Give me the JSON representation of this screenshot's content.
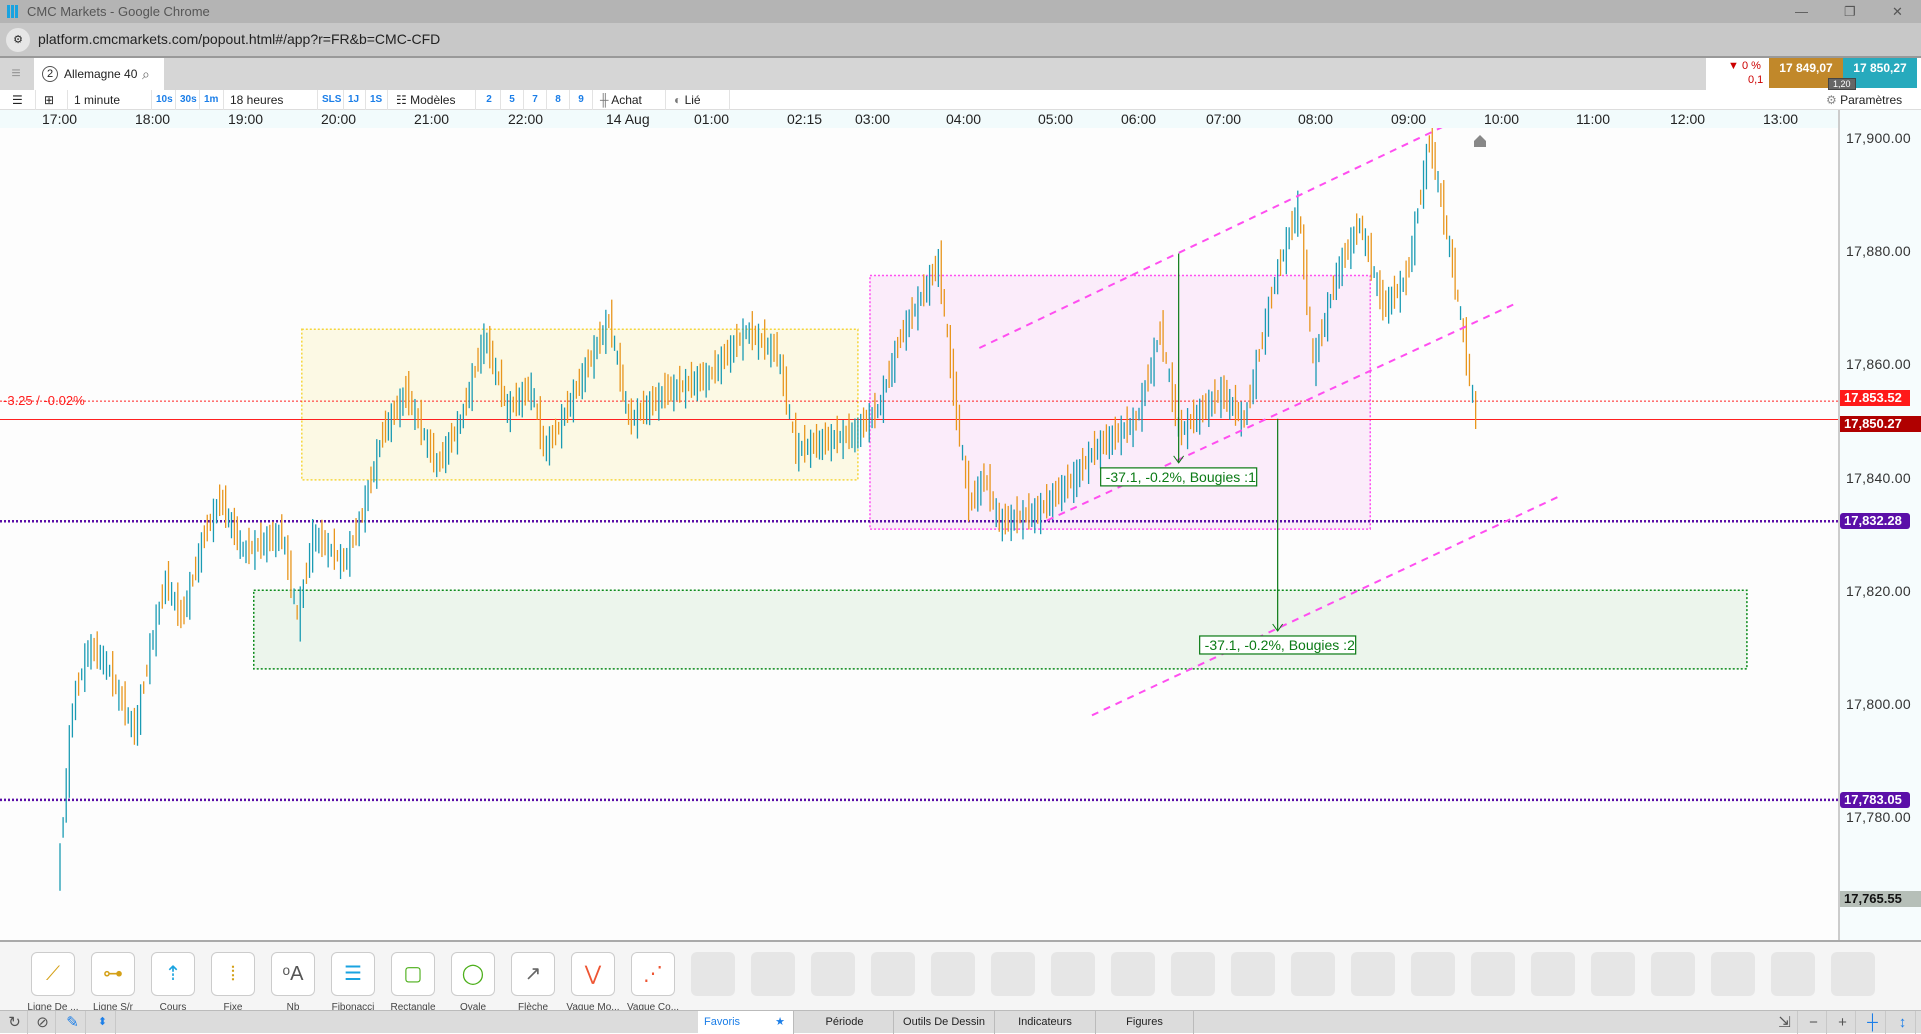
{
  "window": {
    "title": "CMC Markets - Google Chrome",
    "url": "platform.cmcmarkets.com/popout.html#/app?r=FR&b=CMC-CFD"
  },
  "tab": {
    "badge": "2",
    "instrument": "Allemagne 40"
  },
  "quote": {
    "change_pct": "0 %",
    "change_abs": "0,1",
    "sell": "17 849,07",
    "buy": "17 850,27",
    "spread": "1,20",
    "sell_color": "#c1882a",
    "buy_color": "#27aabd"
  },
  "toolbar": {
    "interval": "1 minute",
    "quick": [
      "10s",
      "30s",
      "1m"
    ],
    "range": "18 heures",
    "periods": [
      "SLS",
      "1J",
      "1S"
    ],
    "templates": "Modèles",
    "nums": [
      "2",
      "5",
      "7",
      "8",
      "9"
    ],
    "buy": "Achat",
    "linked": "Lié",
    "settings": "Paramètres"
  },
  "chart_data": {
    "type": "candlestick",
    "x_ticks": [
      "17:00",
      "18:00",
      "19:00",
      "20:00",
      "21:00",
      "22:00",
      "14 Aug",
      "01:00",
      "02:15",
      "03:00",
      "04:00",
      "05:00",
      "06:00",
      "07:00",
      "08:00",
      "09:00",
      "10:00",
      "11:00",
      "12:00",
      "13:00"
    ],
    "y_ticks": [
      "17,900.00",
      "17,880.00",
      "17,860.00",
      "17,840.00",
      "17,820.00",
      "17,800.00",
      "17,780.00"
    ],
    "ylim": [
      17764,
      17903
    ],
    "series": [
      [
        "17:00",
        17768
      ],
      [
        "17:10",
        17800
      ],
      [
        "17:20",
        17810
      ],
      [
        "17:30",
        17808
      ],
      [
        "17:50",
        17795
      ],
      [
        "18:00",
        17810
      ],
      [
        "18:10",
        17822
      ],
      [
        "18:20",
        17815
      ],
      [
        "18:35",
        17830
      ],
      [
        "18:45",
        17836
      ],
      [
        "19:00",
        17827
      ],
      [
        "19:25",
        17830
      ],
      [
        "19:35",
        17815
      ],
      [
        "19:45",
        17830
      ],
      [
        "20:05",
        17825
      ],
      [
        "20:15",
        17832
      ],
      [
        "20:30",
        17848
      ],
      [
        "20:45",
        17855
      ],
      [
        "21:05",
        17842
      ],
      [
        "21:20",
        17850
      ],
      [
        "21:35",
        17865
      ],
      [
        "21:50",
        17852
      ],
      [
        "22:10",
        17856
      ],
      [
        "22:25",
        17845
      ],
      [
        "22:40",
        17848
      ],
      [
        "23:45",
        17868
      ],
      [
        "00:05",
        17850
      ],
      [
        "00:30",
        17855
      ],
      [
        "01:00",
        17858
      ],
      [
        "01:30",
        17866
      ],
      [
        "01:55",
        17862
      ],
      [
        "02:10",
        17845
      ],
      [
        "02:50",
        17848
      ],
      [
        "03:05",
        17852
      ],
      [
        "03:20",
        17865
      ],
      [
        "03:45",
        17878
      ],
      [
        "03:55",
        17855
      ],
      [
        "04:05",
        17835
      ],
      [
        "04:15",
        17840
      ],
      [
        "04:25",
        17832
      ],
      [
        "04:50",
        17834
      ],
      [
        "05:15",
        17840
      ],
      [
        "05:30",
        17845
      ],
      [
        "06:00",
        17850
      ],
      [
        "06:17",
        17866
      ],
      [
        "06:30",
        17848
      ],
      [
        "07:00",
        17855
      ],
      [
        "07:15",
        17850
      ],
      [
        "07:35",
        17875
      ],
      [
        "07:50",
        17888
      ],
      [
        "08:00",
        17860
      ],
      [
        "08:15",
        17876
      ],
      [
        "08:30",
        17885
      ],
      [
        "08:45",
        17870
      ],
      [
        "09:00",
        17875
      ],
      [
        "09:15",
        17900
      ],
      [
        "09:28",
        17880
      ],
      [
        "09:35",
        17868
      ],
      [
        "09:45",
        17850
      ]
    ],
    "bid_line": {
      "label": "-3.25 / -0.02%",
      "price": "17.853.52",
      "value": 17853.52
    },
    "last_price": {
      "price": "17,850.27",
      "value": 17850.27
    },
    "horizontal_levels": [
      {
        "price": "17,832.28",
        "value": 17832.28
      },
      {
        "price": "17,783.05",
        "value": 17783.05
      }
    ],
    "low_marker": "17,765.55",
    "rectangles": [
      {
        "t1": "19:36",
        "t2": "02:50",
        "p1": 17866.2,
        "p2": 17839.6,
        "color": "#f5d63d",
        "fill": "#fcf9e4"
      },
      {
        "t1": "02:58",
        "t2": "08:35",
        "p1": 17875.7,
        "p2": 17830.9,
        "color": "#ff4ef0",
        "fill": "#fbecfa"
      },
      {
        "t1": "19:05",
        "t2": "12:38",
        "p1": 17820.1,
        "p2": 17806.2,
        "color": "#0a8a1a",
        "fill": "#ecf5ec"
      }
    ],
    "channel_lines": [
      {
        "t1": "04:10",
        "p1": 17862.9,
        "t2": "09:22",
        "p2": 17902
      },
      {
        "t1": "04:54",
        "p1": 17832.4,
        "t2": "10:10",
        "p2": 17870.9
      },
      {
        "t1": "05:26",
        "p1": 17798,
        "t2": "10:39",
        "p2": 17836.9
      }
    ],
    "measures": [
      {
        "t": "06:28",
        "p1": 17879.6,
        "p2": 17842.6,
        "label": "-37.1, -0.2%, Bougies :1"
      },
      {
        "t": "07:35",
        "p1": 17850.4,
        "p2": 17812.9,
        "label": "-37.1, -0.2%, Bougies :2"
      }
    ],
    "colors": {
      "up": "#1a9bb3",
      "down": "#e8961e",
      "level": "#5b0fa8",
      "bid": "#ff2020",
      "last": "#c00000"
    }
  },
  "drawing_tools": [
    "Ligne De ...",
    "Ligne S/r",
    "Cours",
    "Fixe",
    "Nb",
    "Fibonacci",
    "Rectangle",
    "Ovale",
    "Flèche",
    "Vague Mo...",
    "Vague Co..."
  ],
  "bottom_tabs": [
    "Favoris",
    "Période",
    "Outils De Dessin",
    "Indicateurs",
    "Figures"
  ]
}
